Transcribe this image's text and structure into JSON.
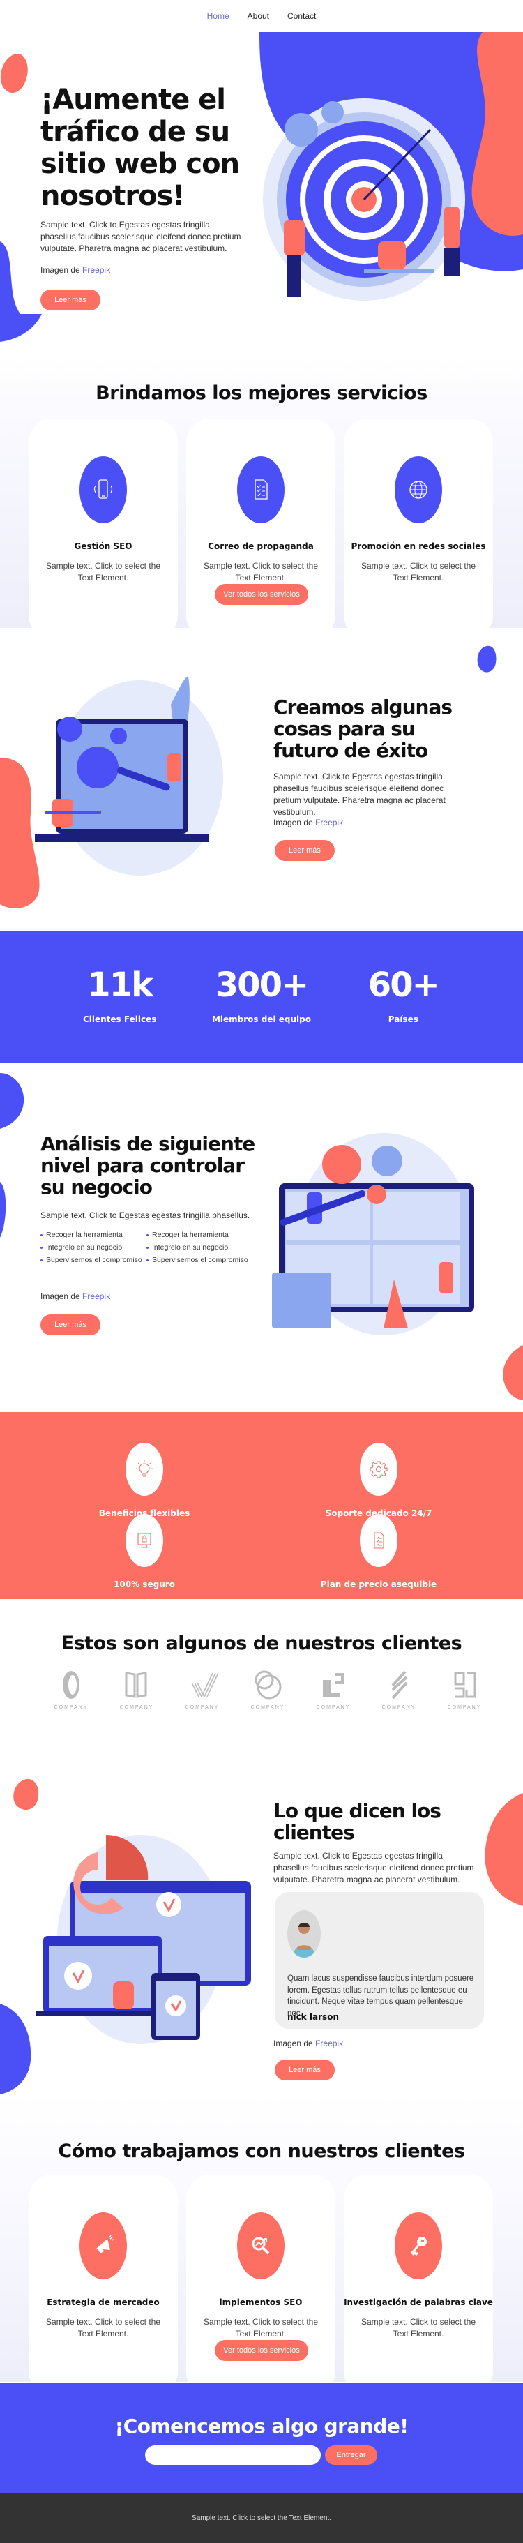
{
  "colors": {
    "primary": "#4b50f6",
    "accent": "#fd6f62",
    "link": "#5c5fd0",
    "footer_bg": "#333333"
  },
  "nav": {
    "items": [
      {
        "label": "Home",
        "active": true
      },
      {
        "label": "About",
        "active": false
      },
      {
        "label": "Contact",
        "active": false
      }
    ]
  },
  "hero": {
    "title": "¡Aumente el tráfico de su sitio web con nosotros!",
    "text": "Sample text. Click to Egestas egestas fringilla phasellus faucibus scelerisque eleifend donec pretium vulputate. Pharetra magna ac placerat vestibulum.",
    "credit_prefix": "Imagen de",
    "credit_link": "Freepik",
    "button": "Leer más",
    "illustration": "target-team-illustration"
  },
  "services": {
    "title": "Brindamos los mejores servicios",
    "cards": [
      {
        "icon": "smartphone-icon",
        "title": "Gestión SEO",
        "text": "Sample text. Click to select the Text Element."
      },
      {
        "icon": "checklist-document-icon",
        "title": "Correo de propaganda",
        "text": "Sample text. Click to select the Text Element."
      },
      {
        "icon": "globe-icon",
        "title": "Promoción en redes sociales",
        "text": "Sample text. Click to select the Text Element."
      }
    ],
    "button": "Ver todos los servicios"
  },
  "future": {
    "title": "Creamos algunas cosas para su futuro de éxito",
    "text": "Sample text. Click to Egestas egestas fringilla phasellus faucibus scelerisque eleifend donec pretium vulputate. Pharetra magna ac placerat vestibulum.",
    "credit_prefix": "Imagen de",
    "credit_link": "Freepik",
    "button": "Leer más",
    "illustration": "laptop-gears-illustration"
  },
  "stats": [
    {
      "value": "11k",
      "label": "Clientes Felices"
    },
    {
      "value": "300+",
      "label": "Miembros del equipo"
    },
    {
      "value": "60+",
      "label": "Países"
    }
  ],
  "analysis": {
    "title": "Análisis de siguiente nivel para controlar su negocio",
    "text": "Sample text. Click to Egestas egestas fringilla phasellus.",
    "bullets_left": [
      "Recoger la herramienta",
      "Integrelo en su negocio",
      "Supervisemos el compromiso"
    ],
    "bullets_right": [
      "Recoger la herramienta",
      "Integrelo en su negocio",
      "Supervisemos el compromiso"
    ],
    "credit_prefix": "Imagen de",
    "credit_link": "Freepik",
    "button": "Leer más",
    "illustration": "website-construction-illustration"
  },
  "benefits": [
    {
      "icon": "lightbulb-icon",
      "label": "Beneficios flexibles"
    },
    {
      "icon": "gear-icon",
      "label": "Soporte dedicado 24/7"
    },
    {
      "icon": "secure-monitor-icon",
      "label": "100% seguro"
    },
    {
      "icon": "document-icon",
      "label": "Plan de precio asequible"
    }
  ],
  "clients": {
    "title": "Estos son algunos de nuestros clientes",
    "logos": [
      "COMPANY",
      "COMPANY",
      "COMPANY",
      "COMPANY",
      "COMPANY",
      "COMPANY",
      "COMPANY"
    ]
  },
  "testimonials": {
    "title": "Lo que dicen los clientes",
    "text": "Sample text. Click to Egestas egestas fringilla phasellus faucibus scelerisque eleifend donec pretium vulputate. Pharetra magna ac placerat vestibulum.",
    "quote": "Quam lacus suspendisse faucibus interdum posuere lorem. Egestas tellus rutrum tellus pellentesque eu tincidunt. Neque vitae tempus quam pellentesque nec.",
    "author": "nick larson",
    "credit_prefix": "Imagen de",
    "credit_link": "Freepik",
    "button": "Leer más",
    "illustration": "devices-checkmarks-illustration"
  },
  "how": {
    "title": "Cómo trabajamos con nuestros clientes",
    "cards": [
      {
        "icon": "megaphone-icon",
        "title": "Estrategia de mercadeo",
        "text": "Sample text. Click to select the Text Element."
      },
      {
        "icon": "seo-search-icon",
        "title": "implementos SEO",
        "text": "Sample text. Click to select the Text Element."
      },
      {
        "icon": "key-icon",
        "title": "Investigación de palabras clave",
        "text": "Sample text. Click to select the Text Element."
      }
    ],
    "button": "Ver todos los servicios"
  },
  "cta": {
    "title": "¡Comencemos algo grande!",
    "input_value": "",
    "input_placeholder": "",
    "button": "Entregar"
  },
  "footer": {
    "text": "Sample text. Click to select the Text Element."
  }
}
